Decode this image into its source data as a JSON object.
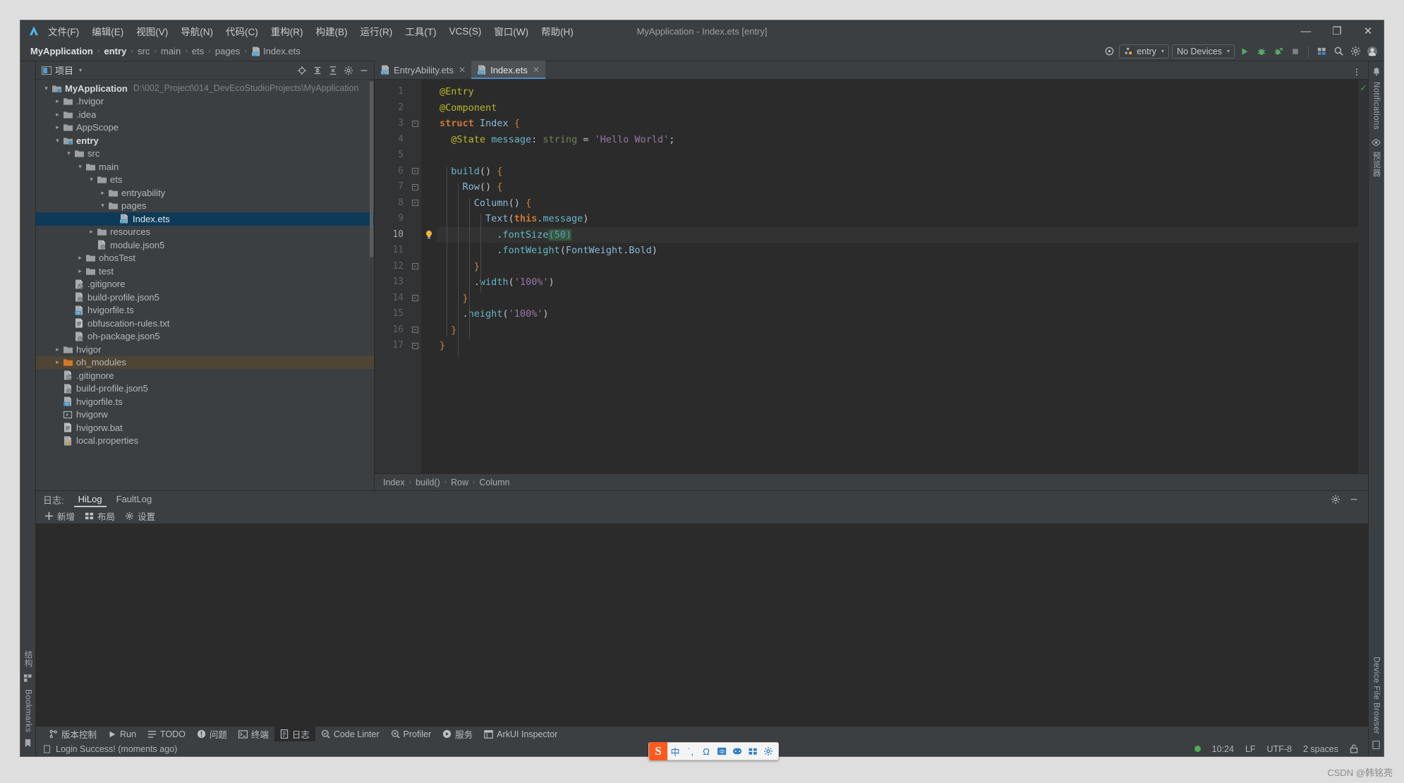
{
  "window": {
    "title": "MyApplication - Index.ets [entry]",
    "minimize": "—",
    "maximize": "❐",
    "close": "✕"
  },
  "menu": {
    "items": [
      {
        "label": "文件(F)"
      },
      {
        "label": "编辑(E)"
      },
      {
        "label": "视图(V)"
      },
      {
        "label": "导航(N)"
      },
      {
        "label": "代码(C)"
      },
      {
        "label": "重构(R)"
      },
      {
        "label": "构建(B)"
      },
      {
        "label": "运行(R)"
      },
      {
        "label": "工具(T)"
      },
      {
        "label": "VCS(S)"
      },
      {
        "label": "窗口(W)"
      },
      {
        "label": "帮助(H)"
      }
    ]
  },
  "navbar": {
    "breadcrumb": [
      "MyApplication",
      "entry",
      "src",
      "main",
      "ets",
      "pages",
      "Index.ets"
    ],
    "separator": "›",
    "run_config": "entry",
    "devices": "No Devices",
    "caret": "▾"
  },
  "project_panel": {
    "title": "项目",
    "caret": "▾",
    "tree": [
      {
        "depth": 0,
        "arrow": "expanded",
        "icon": "module-folder",
        "label": "MyApplication",
        "bold": true,
        "path": "D:\\002_Project\\014_DevEcoStudioProjects\\MyApplication"
      },
      {
        "depth": 1,
        "arrow": "collapsed",
        "icon": "folder",
        "label": ".hvigor"
      },
      {
        "depth": 1,
        "arrow": "collapsed",
        "icon": "folder",
        "label": ".idea"
      },
      {
        "depth": 1,
        "arrow": "collapsed",
        "icon": "folder",
        "label": "AppScope"
      },
      {
        "depth": 1,
        "arrow": "expanded",
        "icon": "module-folder",
        "label": "entry",
        "bold": true
      },
      {
        "depth": 2,
        "arrow": "expanded",
        "icon": "folder",
        "label": "src"
      },
      {
        "depth": 3,
        "arrow": "expanded",
        "icon": "folder",
        "label": "main"
      },
      {
        "depth": 4,
        "arrow": "expanded",
        "icon": "folder",
        "label": "ets"
      },
      {
        "depth": 5,
        "arrow": "collapsed",
        "icon": "folder",
        "label": "entryability"
      },
      {
        "depth": 5,
        "arrow": "expanded",
        "icon": "folder",
        "label": "pages"
      },
      {
        "depth": 6,
        "arrow": "none",
        "icon": "ets-file",
        "label": "Index.ets",
        "selected": true
      },
      {
        "depth": 4,
        "arrow": "collapsed",
        "icon": "folder",
        "label": "resources"
      },
      {
        "depth": 4,
        "arrow": "none",
        "icon": "json5-file",
        "label": "module.json5"
      },
      {
        "depth": 3,
        "arrow": "collapsed",
        "icon": "folder",
        "label": "ohosTest"
      },
      {
        "depth": 3,
        "arrow": "collapsed",
        "icon": "folder",
        "label": "test"
      },
      {
        "depth": 2,
        "arrow": "none",
        "icon": "gitignore-file",
        "label": ".gitignore"
      },
      {
        "depth": 2,
        "arrow": "none",
        "icon": "json5-file",
        "label": "build-profile.json5"
      },
      {
        "depth": 2,
        "arrow": "none",
        "icon": "ts-file",
        "label": "hvigorfile.ts"
      },
      {
        "depth": 2,
        "arrow": "none",
        "icon": "txt-file",
        "label": "obfuscation-rules.txt"
      },
      {
        "depth": 2,
        "arrow": "none",
        "icon": "json5-file",
        "label": "oh-package.json5"
      },
      {
        "depth": 1,
        "arrow": "collapsed",
        "icon": "folder",
        "label": "hvigor"
      },
      {
        "depth": 1,
        "arrow": "collapsed",
        "icon": "orange-folder",
        "label": "oh_modules",
        "highlight": true
      },
      {
        "depth": 1,
        "arrow": "none",
        "icon": "gitignore-file",
        "label": ".gitignore"
      },
      {
        "depth": 1,
        "arrow": "none",
        "icon": "json5-file",
        "label": "build-profile.json5"
      },
      {
        "depth": 1,
        "arrow": "none",
        "icon": "ts-file",
        "label": "hvigorfile.ts"
      },
      {
        "depth": 1,
        "arrow": "none",
        "icon": "script-file",
        "label": "hvigorw"
      },
      {
        "depth": 1,
        "arrow": "none",
        "icon": "txt-file",
        "label": "hvigorw.bat"
      },
      {
        "depth": 1,
        "arrow": "none",
        "icon": "properties-file",
        "label": "local.properties"
      }
    ]
  },
  "editor": {
    "tabs": [
      {
        "label": "EntryAbility.ets",
        "icon": "ets-file",
        "active": false,
        "close": "✕"
      },
      {
        "label": "Index.ets",
        "icon": "ets-file",
        "active": true,
        "close": "✕"
      }
    ],
    "line_numbers": [
      "1",
      "2",
      "3",
      "4",
      "5",
      "6",
      "7",
      "8",
      "9",
      "10",
      "11",
      "12",
      "13",
      "14",
      "15",
      "16",
      "17"
    ],
    "current_line": 10,
    "breadcrumb": [
      "Index",
      "build()",
      "Row",
      "Column"
    ],
    "breadcrumb_separator": "›",
    "code": [
      {
        "n": 1,
        "text": "@Entry"
      },
      {
        "n": 2,
        "text": "@Component"
      },
      {
        "n": 3,
        "text": "struct Index {"
      },
      {
        "n": 4,
        "text": "  @State message: string = 'Hello World';"
      },
      {
        "n": 5,
        "text": ""
      },
      {
        "n": 6,
        "text": "  build() {"
      },
      {
        "n": 7,
        "text": "    Row() {"
      },
      {
        "n": 8,
        "text": "      Column() {"
      },
      {
        "n": 9,
        "text": "        Text(this.message)"
      },
      {
        "n": 10,
        "text": "          .fontSize(50)"
      },
      {
        "n": 11,
        "text": "          .fontWeight(FontWeight.Bold)"
      },
      {
        "n": 12,
        "text": "      }"
      },
      {
        "n": 13,
        "text": "      .width('100%')"
      },
      {
        "n": 14,
        "text": "    }"
      },
      {
        "n": 15,
        "text": "    .height('100%')"
      },
      {
        "n": 16,
        "text": "  }"
      },
      {
        "n": 17,
        "text": "}"
      }
    ]
  },
  "log_panel": {
    "label": "日志:",
    "tabs": [
      {
        "label": "HiLog",
        "active": true
      },
      {
        "label": "FaultLog",
        "active": false
      }
    ],
    "toolbar": [
      {
        "icon": "plus-icon",
        "label": "新增"
      },
      {
        "icon": "layout-icon",
        "label": "布局"
      },
      {
        "icon": "gear-icon",
        "label": "设置"
      }
    ]
  },
  "status_tools": [
    {
      "icon": "vcs-icon",
      "label": "版本控制",
      "active": false
    },
    {
      "icon": "run-icon",
      "label": "Run",
      "active": false
    },
    {
      "icon": "todo-icon",
      "label": "TODO",
      "active": false
    },
    {
      "icon": "problems-icon",
      "label": "问题",
      "active": false
    },
    {
      "icon": "terminal-icon",
      "label": "终端",
      "active": false
    },
    {
      "icon": "log-icon",
      "label": "日志",
      "active": true
    },
    {
      "icon": "code-linter-icon",
      "label": "Code Linter",
      "active": false
    },
    {
      "icon": "profiler-icon",
      "label": "Profiler",
      "active": false
    },
    {
      "icon": "services-icon",
      "label": "服务",
      "active": false
    },
    {
      "icon": "arkui-inspector-icon",
      "label": "ArkUI Inspector",
      "active": false
    }
  ],
  "status_bar": {
    "message": "Login Success! (moments ago)",
    "time": "10:24",
    "line_sep": "LF",
    "encoding": "UTF-8",
    "indent": "2 spaces",
    "lock": "🔓"
  },
  "left_rail": {
    "top": [],
    "bottom": [
      {
        "label": "结构",
        "icon": "structure-icon"
      },
      {
        "label": "Bookmarks",
        "icon": "bookmark-icon"
      }
    ]
  },
  "right_rail": {
    "top": [
      {
        "label": "Notifications",
        "icon": "bell-icon"
      },
      {
        "label": "预览器",
        "icon": "eye-icon"
      }
    ],
    "bottom": [
      {
        "label": "Device File Browser",
        "icon": "device-icon"
      }
    ]
  },
  "ime": {
    "logo": "S",
    "buttons": [
      "中",
      "˙,",
      "Ω",
      "keyboard-icon",
      "emoji-icon",
      "apps-icon",
      "settings-icon"
    ]
  },
  "watermark": "CSDN @韩铭亮",
  "colors": {
    "accent": "#4a88c7",
    "selection": "#0d3a58",
    "highlight_row": "#4e4535",
    "editor_bg": "#2b2b2b",
    "panel_bg": "#3c3f41",
    "green": "#4caf50",
    "orange": "#ff5a1f"
  }
}
